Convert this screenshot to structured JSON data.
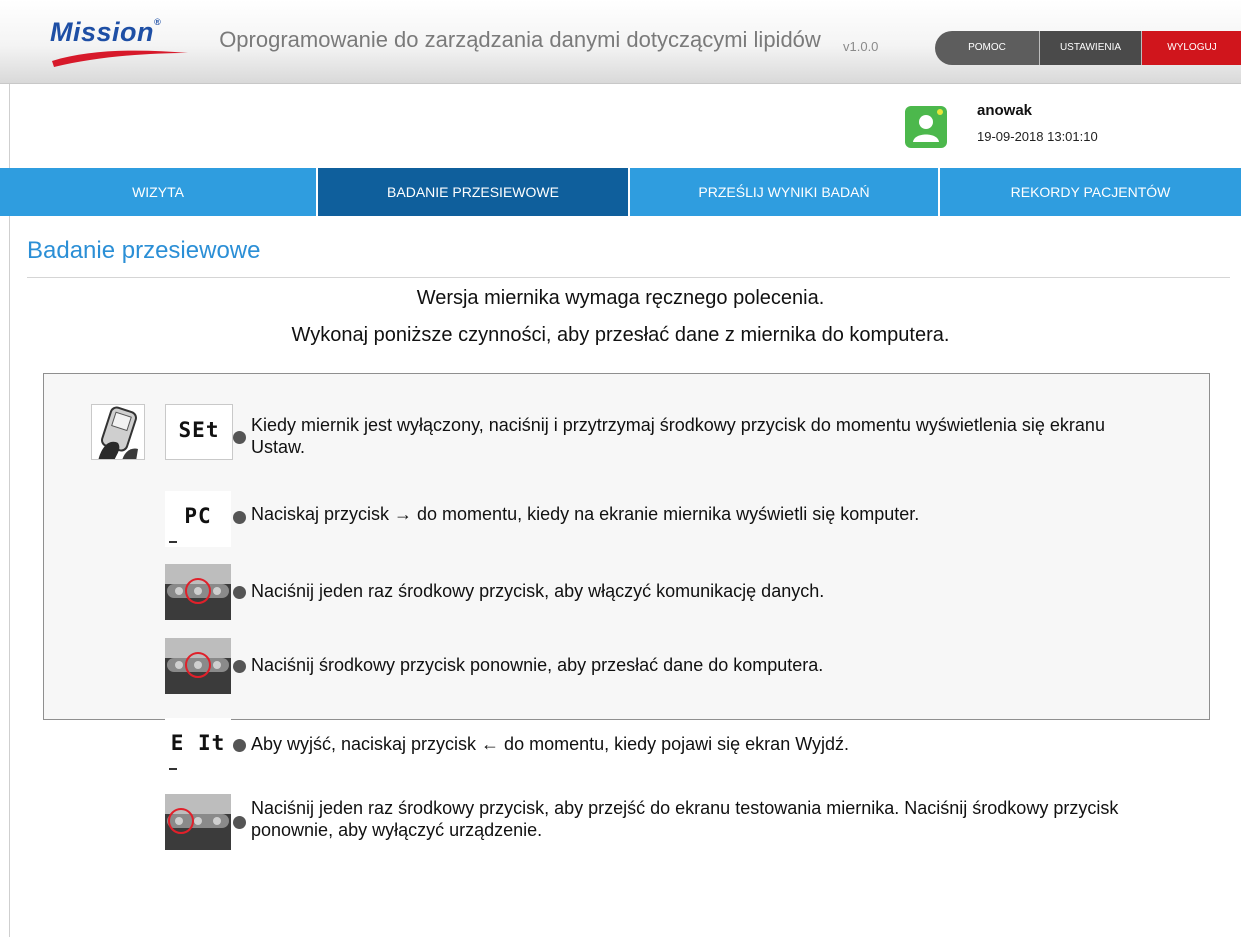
{
  "header": {
    "logo_text": "Mission",
    "logo_reg": "®",
    "app_title": "Oprogramowanie do zarządzania danymi dotyczącymi lipidów",
    "version": "v1.0.0",
    "buttons": {
      "help": "POMOC",
      "settings": "USTAWIENIA",
      "logout": "WYLOGUJ"
    },
    "colors": {
      "logo": "#1e4fa5",
      "logout": "#d0151c"
    }
  },
  "user": {
    "username": "anowak",
    "datetime": "19-09-2018 13:01:10",
    "avatar_icon": "user-avatar-icon"
  },
  "nav": {
    "tabs": [
      {
        "label": "WIZYTA",
        "active": false
      },
      {
        "label": "BADANIE PRZESIEWOWE",
        "active": true
      },
      {
        "label": "PRZEŚLIJ WYNIKI BADAŃ",
        "active": false
      },
      {
        "label": "REKORDY PACJENTÓW",
        "active": false
      }
    ],
    "colors": {
      "tab": "#2f9ddf",
      "active": "#0f5f9c"
    }
  },
  "main": {
    "title": "Badanie przesiewowe",
    "message_line1": "Wersja miernika wymaga ręcznego polecenia.",
    "message_line2": "Wykonaj poniższe czynności, aby przesłać dane z miernika do komputera.",
    "steps": [
      {
        "lcd": "SEt",
        "icon": "meter-hand-icon",
        "text": "Kiedy miernik jest wyłączony, naciśnij i przytrzymaj środkowy przycisk do momentu wyświetlenia się ekranu Ustaw."
      },
      {
        "lcd": "PC",
        "icon": "lcd-pc-icon",
        "text": "Naciskaj przycisk → do momentu, kiedy na ekranie miernika wyświetli się komputer."
      },
      {
        "lcd": "",
        "icon": "meter-middle-button-icon",
        "text": "Naciśnij jeden raz środkowy przycisk, aby włączyć komunikację danych."
      },
      {
        "lcd": "",
        "icon": "meter-middle-button-icon",
        "text": "Naciśnij środkowy przycisk ponownie, aby przesłać dane do komputera."
      },
      {
        "lcd": "E It",
        "icon": "lcd-exit-icon",
        "text": "Aby wyjść, naciskaj przycisk ← do momentu, kiedy pojawi się ekran Wyjdź."
      },
      {
        "lcd": "",
        "icon": "meter-left-button-icon",
        "text": "Naciśnij jeden raz środkowy przycisk, aby przejść do ekranu testowania miernika. Naciśnij środkowy przycisk ponownie, aby wyłączyć urządzenie."
      }
    ]
  }
}
